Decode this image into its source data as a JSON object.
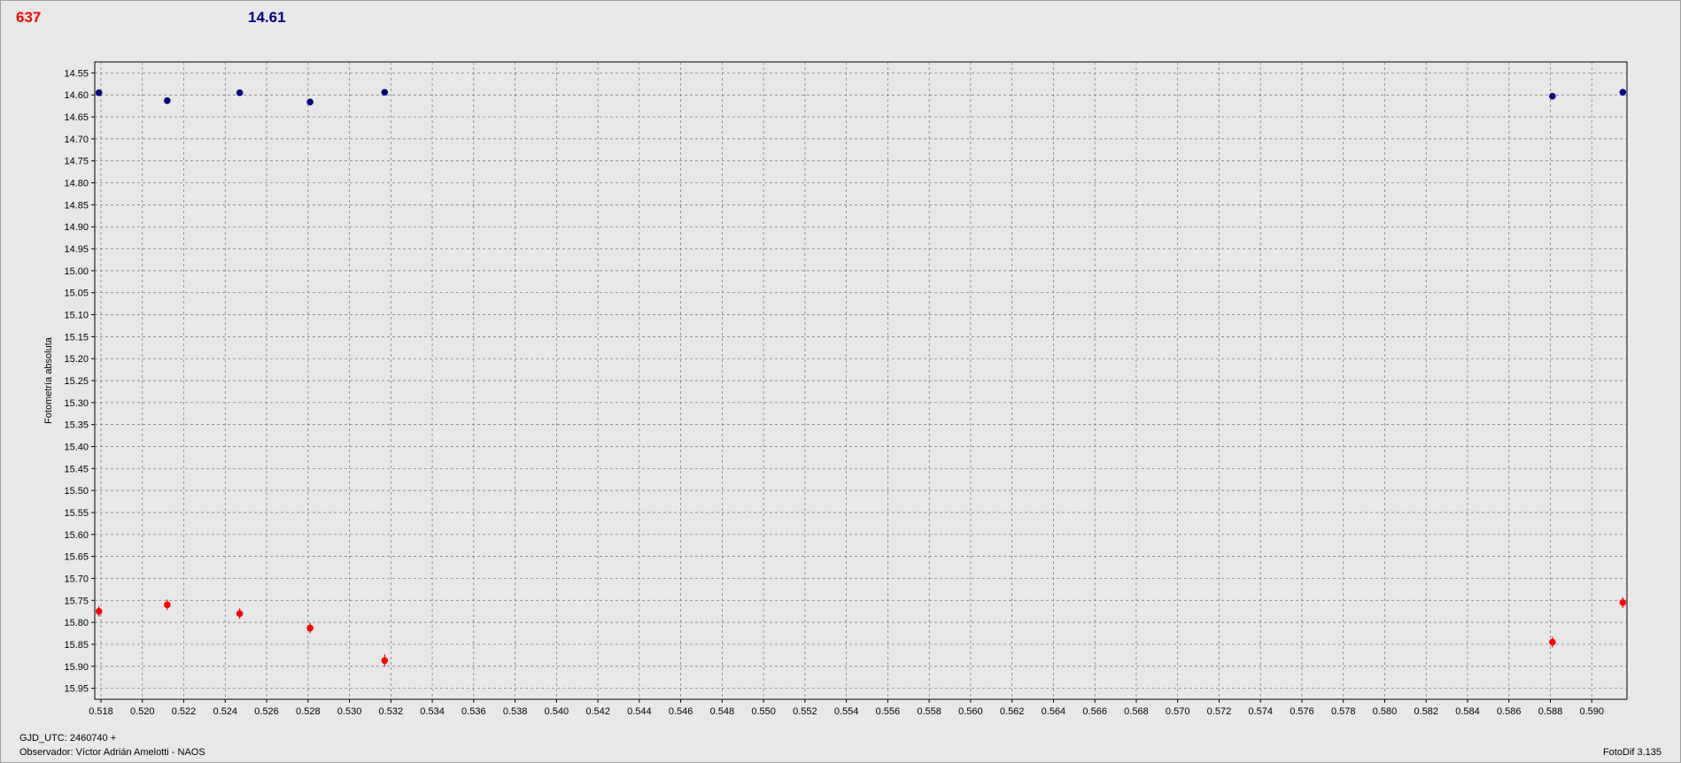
{
  "header": {
    "left_value": "637",
    "right_value": "14.61"
  },
  "footer": {
    "gjd_label": "GJD_UTC: 2460740 +",
    "observer": "Observador: Víctor Adrián Amelotti - NAOS",
    "software": "FotoDif 3.135"
  },
  "colors": {
    "series_red": "#ff0000",
    "series_blue": "#000080",
    "plot_bg": "#e8e8e8",
    "grid": "#707070"
  },
  "chart_data": {
    "type": "scatter",
    "title": "",
    "xlabel": "",
    "ylabel": "Fotometría absoluta",
    "y_inverted": true,
    "grid": true,
    "xlim": [
      0.5177,
      0.5917
    ],
    "ylim": [
      14.525,
      15.975
    ],
    "x_ticks": [
      "0.518",
      "0.520",
      "0.522",
      "0.524",
      "0.526",
      "0.528",
      "0.530",
      "0.532",
      "0.534",
      "0.536",
      "0.538",
      "0.540",
      "0.542",
      "0.544",
      "0.546",
      "0.548",
      "0.550",
      "0.552",
      "0.554",
      "0.556",
      "0.558",
      "0.560",
      "0.562",
      "0.564",
      "0.566",
      "0.568",
      "0.570",
      "0.572",
      "0.574",
      "0.576",
      "0.578",
      "0.580",
      "0.582",
      "0.584",
      "0.586",
      "0.588",
      "0.590"
    ],
    "y_ticks": [
      "14.55",
      "14.60",
      "14.65",
      "14.70",
      "14.75",
      "14.80",
      "14.85",
      "14.90",
      "14.95",
      "15.00",
      "15.05",
      "15.10",
      "15.15",
      "15.20",
      "15.25",
      "15.30",
      "15.35",
      "15.40",
      "15.45",
      "15.50",
      "15.55",
      "15.60",
      "15.65",
      "15.70",
      "15.75",
      "15.80",
      "15.85",
      "15.90",
      "15.95"
    ],
    "series": [
      {
        "color": "#ff0000",
        "points": [
          {
            "x": 0.5179,
            "y": 15.775,
            "err": 0.012
          },
          {
            "x": 0.5212,
            "y": 15.76,
            "err": 0.012
          },
          {
            "x": 0.5247,
            "y": 15.78,
            "err": 0.012
          },
          {
            "x": 0.5281,
            "y": 15.813,
            "err": 0.012
          },
          {
            "x": 0.5317,
            "y": 15.887,
            "err": 0.014
          },
          {
            "x": 0.5881,
            "y": 15.845,
            "err": 0.012
          },
          {
            "x": 0.5915,
            "y": 15.755,
            "err": 0.012
          }
        ]
      },
      {
        "color": "#000080",
        "points": [
          {
            "x": 0.5179,
            "y": 14.595,
            "err": 0.005
          },
          {
            "x": 0.5212,
            "y": 14.613,
            "err": 0.005
          },
          {
            "x": 0.5247,
            "y": 14.595,
            "err": 0.005
          },
          {
            "x": 0.5281,
            "y": 14.616,
            "err": 0.005
          },
          {
            "x": 0.5317,
            "y": 14.594,
            "err": 0.005
          },
          {
            "x": 0.5881,
            "y": 14.603,
            "err": 0.005
          },
          {
            "x": 0.5915,
            "y": 14.594,
            "err": 0.005
          }
        ]
      }
    ]
  }
}
